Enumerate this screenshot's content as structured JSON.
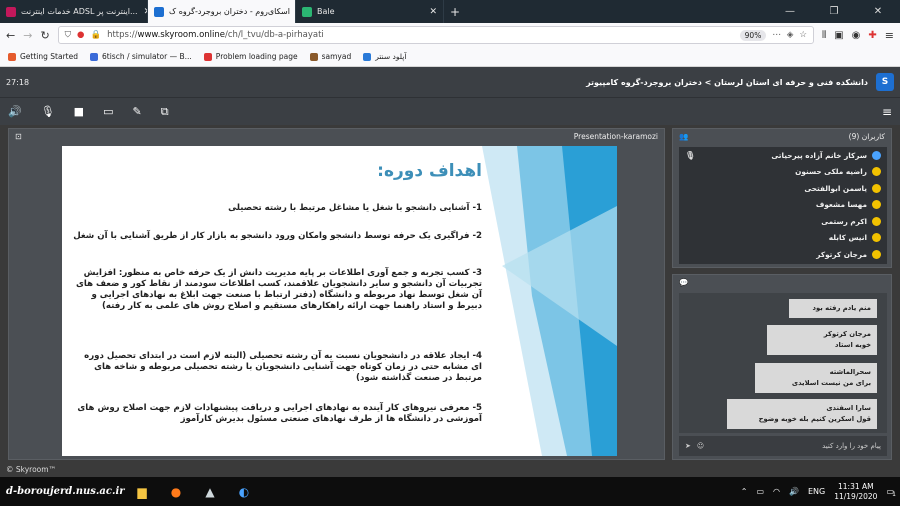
{
  "browser": {
    "tabs": [
      {
        "label": "خدمات اینترنت ADSL اینترنت پر...",
        "active": false,
        "icon_color": "#c2185b"
      },
      {
        "label": "اسکای‌روم - دختران بروجرد-گروه ک",
        "active": true,
        "icon_color": "#1d6fd1"
      },
      {
        "label": "Bale",
        "active": false,
        "icon_color": "#2bb673"
      }
    ],
    "new_tab": "+",
    "window_controls": {
      "minimize": "—",
      "maximize": "❐",
      "close": "✕"
    },
    "url": {
      "scheme": "https://",
      "host": "www.skyroom.online",
      "path": "/ch/l_tvu/db-a-pirhayati"
    },
    "zoom": "90%",
    "bookmarks": [
      {
        "label": "Getting Started",
        "icon_color": "#e55b2d"
      },
      {
        "label": "6tisch / simulator — B...",
        "icon_color": "#3a6ad8"
      },
      {
        "label": "Problem loading page",
        "icon_color": "#d33"
      },
      {
        "label": "samyad",
        "icon_color": "#8a5a2b"
      },
      {
        "label": "آپلود سنتر",
        "icon_color": "#2a7ad8"
      }
    ]
  },
  "app": {
    "timer": "27:18",
    "room_title": "دانشکده فنی و حرفه ای استان لرستان > دختران بروجرد-گروه کامپیوتر",
    "logo_text": "S",
    "toolbar": [
      "speaker-icon",
      "mic-icon",
      "camera-icon",
      "screen-share-icon",
      "draw-icon",
      "presentation-icon"
    ],
    "presentation": {
      "title": "Presentation-karamozi",
      "slide": {
        "heading": "اهداف دوره:",
        "paragraphs": [
          "1- آشنایی دانشجو با شغل یا مشاغل مرتبط با رشته تحصیلی",
          "2- فراگیری یک حرفه توسط دانشجو وامکان ورود دانشجو به بازار کار از طریق آشنایی با آن شغل",
          "3- کسب تجربه و جمع آوری اطلاعات بر پایه مدیریت دانش از یک حرفه خاص به منظور: افزایش تجربیات آن دانشجو و سایر دانشجویان علاقمند، کسب اطلاعات سودمند از نقاط کور و ضعف های آن شغل توسط نهاد مربوطه و دانشگاه (دفتر ارتباط با صنعت جهت ابلاغ به نهادهای اجرایی و دبیرط و استاد راهنما جهت ارائه راهکارهای مستقیم و اصلاح روش های علمی به کار رفته)",
          "4- ایجاد علاقه در دانشجویان نسبت به آن رشته تحصیلی (البته لازم است در ابتدای تحصیل دوره ای مشابه حتی در زمان کوتاه جهت آشنایی دانشجویان با رشته تحصیلی مربوطه و شاخه های مرتبط در صنعت گذاشته شود)",
          "5- معرفی نیروهای کار آینده به نهادهای اجرایی و دریافت پیشنهادات لازم جهت اصلاح روش های آموزشی در دانشگاه ها از طرف نهادهای صنعتی مسئول بدیرش کارآموز"
        ]
      }
    },
    "users_panel": {
      "title": "کاربران (9)",
      "users": [
        {
          "name": "سرکار خانم آزاده پیرحیاتی",
          "host": true
        },
        {
          "name": "راضیه ملکی حسنون",
          "host": false
        },
        {
          "name": "یاسمن ابوالفتحی",
          "host": false
        },
        {
          "name": "مهسا مشعوف",
          "host": false
        },
        {
          "name": "اکرم رستمی",
          "host": false
        },
        {
          "name": "انیس کابله",
          "host": false
        },
        {
          "name": "مرجان کرتوکر",
          "host": false
        }
      ]
    },
    "chat_panel": {
      "messages": [
        {
          "author": "",
          "text": "منم یادم رفته بود"
        },
        {
          "author": "مرجان کرتوکر",
          "text": "خوبه استاد"
        },
        {
          "author": "سحرالماشته",
          "text": "برای من نیست اسلایدی"
        },
        {
          "author": "سارا اسفندی",
          "text": "قول اسکرین کنیم بله خوبه وضوح"
        }
      ],
      "input_placeholder": "پیام خود را وارد کنید"
    },
    "footer": "© Skyroom™"
  },
  "taskbar": {
    "start_label": "d-boroujerd.nus.ac.ir",
    "language": "ENG",
    "time": "11:31 AM",
    "date": "11/19/2020",
    "notification_count": "1"
  }
}
